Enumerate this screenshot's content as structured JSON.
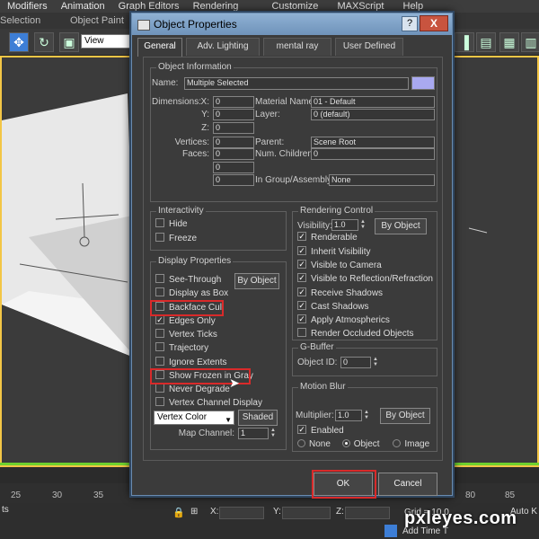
{
  "menubar": [
    "Modifiers",
    "Animation",
    "Graph Editors",
    "Rendering",
    "Customize",
    "MAXScript",
    "Help"
  ],
  "ribbon": {
    "left": "Selection",
    "center": "Object Paint"
  },
  "toolbar": {
    "view_select": "View"
  },
  "dialog": {
    "title": "Object Properties",
    "help_label": "?",
    "close_label": "X",
    "tabs": [
      "General",
      "Adv. Lighting",
      "mental ray",
      "User Defined"
    ],
    "object_information": {
      "legend": "Object Information",
      "name_label": "Name:",
      "name_value": "Multiple Selected",
      "name_color": "#a9a9f0",
      "dimensions_label": "Dimensions:",
      "x_label": "X:",
      "x_value": "0",
      "y_label": "Y:",
      "y_value": "0",
      "z_label": "Z:",
      "z_value": "0",
      "vertices_label": "Vertices:",
      "vertices_value": "0",
      "faces_label": "Faces:",
      "faces_value": "0",
      "extra_value_1": "0",
      "extra_value_2": "0",
      "material_label": "Material Name:",
      "material_value": "01 - Default",
      "layer_label": "Layer:",
      "layer_value": "0 (default)",
      "parent_label": "Parent:",
      "parent_value": "Scene Root",
      "children_label": "Num. Children:",
      "children_value": "0",
      "group_label": "In Group/Assembly:",
      "group_value": "None"
    },
    "interactivity": {
      "legend": "Interactivity",
      "items": [
        {
          "label": "Hide",
          "checked": false
        },
        {
          "label": "Freeze",
          "checked": false
        }
      ]
    },
    "display_properties": {
      "legend": "Display Properties",
      "by_object_label": "By Object",
      "items": [
        {
          "label": "See-Through",
          "checked": false
        },
        {
          "label": "Display as Box",
          "checked": false
        },
        {
          "label": "Backface Cull",
          "checked": false
        },
        {
          "label": "Edges Only",
          "checked": true
        },
        {
          "label": "Vertex Ticks",
          "checked": false
        },
        {
          "label": "Trajectory",
          "checked": false
        },
        {
          "label": "Ignore Extents",
          "checked": false
        },
        {
          "label": "Show Frozen in Gray",
          "checked": false
        },
        {
          "label": "Never Degrade",
          "checked": false
        },
        {
          "label": "Vertex Channel Display",
          "checked": false
        }
      ],
      "vertex_color_value": "Vertex Color",
      "shaded_label": "Shaded",
      "map_channel_label": "Map Channel:",
      "map_channel_value": "1"
    },
    "rendering_control": {
      "legend": "Rendering Control",
      "visibility_label": "Visibility:",
      "visibility_value": "1.0",
      "by_object_label": "By Object",
      "items": [
        {
          "label": "Renderable",
          "checked": true
        },
        {
          "label": "Inherit Visibility",
          "checked": true
        },
        {
          "label": "Visible to Camera",
          "checked": true
        },
        {
          "label": "Visible to Reflection/Refraction",
          "checked": true
        },
        {
          "label": "Receive Shadows",
          "checked": true
        },
        {
          "label": "Cast Shadows",
          "checked": true
        },
        {
          "label": "Apply Atmospherics",
          "checked": true
        },
        {
          "label": "Render Occluded Objects",
          "checked": false
        }
      ]
    },
    "gbuffer": {
      "legend": "G-Buffer",
      "object_id_label": "Object ID:",
      "object_id_value": "0"
    },
    "motion_blur": {
      "legend": "Motion Blur",
      "multiplier_label": "Multiplier:",
      "multiplier_value": "1.0",
      "by_object_label": "By Object",
      "enabled_label": "Enabled",
      "enabled_checked": true,
      "options": [
        {
          "label": "None",
          "selected": false
        },
        {
          "label": "Object",
          "selected": true
        },
        {
          "label": "Image",
          "selected": false
        }
      ]
    },
    "ok_label": "OK",
    "cancel_label": "Cancel"
  },
  "timeline": {
    "ticks": [
      "25",
      "30",
      "35",
      "40",
      "45",
      "80",
      "85"
    ]
  },
  "statusbar": {
    "x_label": "X:",
    "y_label": "Y:",
    "z_label": "Z:",
    "grid_text": "Grid = 10.0",
    "auto_key": "Auto K",
    "add_time_tag": "Add Time T",
    "left_text": "ts"
  },
  "watermark": "pxleyes.com",
  "highlight_color": "#d92a2a"
}
